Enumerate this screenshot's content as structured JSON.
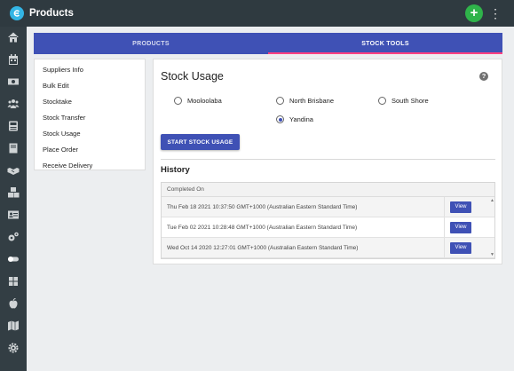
{
  "header": {
    "app_title": "Products",
    "add_label": "+",
    "more_label": "⋮"
  },
  "sidebar": {
    "items": [
      {
        "icon": "home-icon"
      },
      {
        "icon": "calendar-icon"
      },
      {
        "icon": "money-icon"
      },
      {
        "icon": "people-icon"
      },
      {
        "icon": "register-icon"
      },
      {
        "icon": "book-icon"
      },
      {
        "icon": "handshake-icon"
      },
      {
        "icon": "boxes-icon"
      },
      {
        "icon": "id-card-icon"
      },
      {
        "icon": "settings-icon"
      },
      {
        "icon": "toggle-icon"
      },
      {
        "icon": "windows-icon"
      },
      {
        "icon": "apple-icon"
      },
      {
        "icon": "map-icon"
      },
      {
        "icon": "gear-icon"
      }
    ]
  },
  "tabs": [
    {
      "label": "PRODUCTS",
      "active": false
    },
    {
      "label": "STOCK TOOLS",
      "active": true
    }
  ],
  "menu": {
    "items": [
      "Suppliers Info",
      "Bulk Edit",
      "Stocktake",
      "Stock Transfer",
      "Stock Usage",
      "Place Order",
      "Receive Delivery"
    ]
  },
  "stock_usage": {
    "title": "Stock Usage",
    "help_label": "?",
    "locations": [
      {
        "label": "Mooloolaba",
        "checked": false
      },
      {
        "label": "North Brisbane",
        "checked": false
      },
      {
        "label": "South Shore",
        "checked": false
      },
      {
        "label": "Yandina",
        "checked": true
      }
    ],
    "start_button": "START STOCK USAGE"
  },
  "history": {
    "title": "History",
    "column_header": "Completed On",
    "view_label": "View",
    "rows": [
      "Thu Feb 18 2021 10:37:50 GMT+1000 (Australian Eastern Standard Time)",
      "Tue Feb 02 2021 10:28:48 GMT+1000 (Australian Eastern Standard Time)",
      "Wed Oct 14 2020 12:27:01 GMT+1000 (Australian Eastern Standard Time)"
    ]
  },
  "colors": {
    "primary": "#3f51b5",
    "topbar": "#2f3a40",
    "sidebar": "#333e44",
    "add_button": "#2fb34a",
    "tab_indicator": "#ff4081"
  }
}
